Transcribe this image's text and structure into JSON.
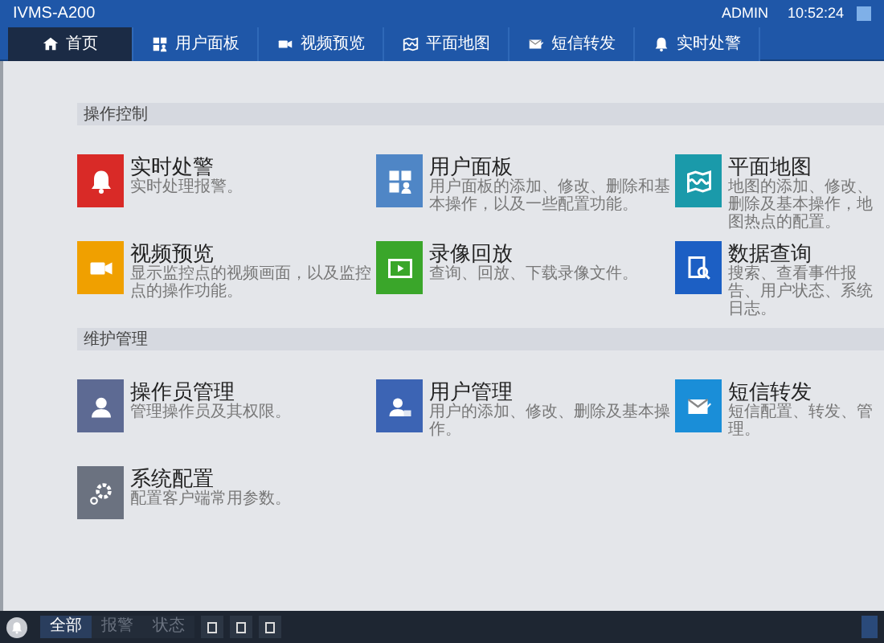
{
  "header": {
    "title": "IVMS-A200",
    "user": "ADMIN",
    "time": "10:52:24"
  },
  "tabs": [
    {
      "label": "首页",
      "kind": "home",
      "selected": true
    },
    {
      "label": "用户面板",
      "kind": "panel",
      "selected": false
    },
    {
      "label": "视频预览",
      "kind": "video",
      "selected": false
    },
    {
      "label": "平面地图",
      "kind": "map",
      "selected": false
    },
    {
      "label": "短信转发",
      "kind": "sms",
      "selected": false
    },
    {
      "label": "实时处警",
      "kind": "bell",
      "selected": false
    }
  ],
  "sections": [
    {
      "title": "操作控制",
      "items": [
        {
          "title": "实时处警",
          "description": "实时处理报警。",
          "kind": "bell",
          "color": "#d92a27"
        },
        {
          "title": "用户面板",
          "description": "用户面板的添加、修改、删除和基本操作，以及一些配置功能。",
          "kind": "panel",
          "color": "#4f86c6"
        },
        {
          "title": "平面地图",
          "description": "地图的添加、修改、删除及基本操作，地图热点的配置。",
          "kind": "map",
          "color": "#1a9aaa"
        },
        {
          "title": "视频预览",
          "description": "显示监控点的视频画面，以及监控点的操作功能。",
          "kind": "video",
          "color": "#f0a000"
        },
        {
          "title": "录像回放",
          "description": "查询、回放、下载录像文件。",
          "kind": "playback",
          "color": "#3aa62a"
        },
        {
          "title": "数据查询",
          "description": "搜索、查看事件报告、用户状态、系统日志。",
          "kind": "search",
          "color": "#1c5fc4"
        }
      ]
    },
    {
      "title": "维护管理",
      "items": [
        {
          "title": "操作员管理",
          "description": "管理操作员及其权限。",
          "kind": "operator",
          "color": "#5d6a93"
        },
        {
          "title": "用户管理",
          "description": "用户的添加、修改、删除及基本操作。",
          "kind": "user",
          "color": "#3c64b4"
        },
        {
          "title": "短信转发",
          "description": "短信配置、转发、管理。",
          "kind": "sms",
          "color": "#1a8ed8"
        },
        {
          "title": "系统配置",
          "description": "配置客户端常用参数。",
          "kind": "gear",
          "color": "#6b7280"
        }
      ]
    }
  ],
  "footer": {
    "filters": [
      {
        "label": "全部",
        "selected": true
      },
      {
        "label": "报警",
        "selected": false
      },
      {
        "label": "状态",
        "selected": false
      }
    ]
  }
}
